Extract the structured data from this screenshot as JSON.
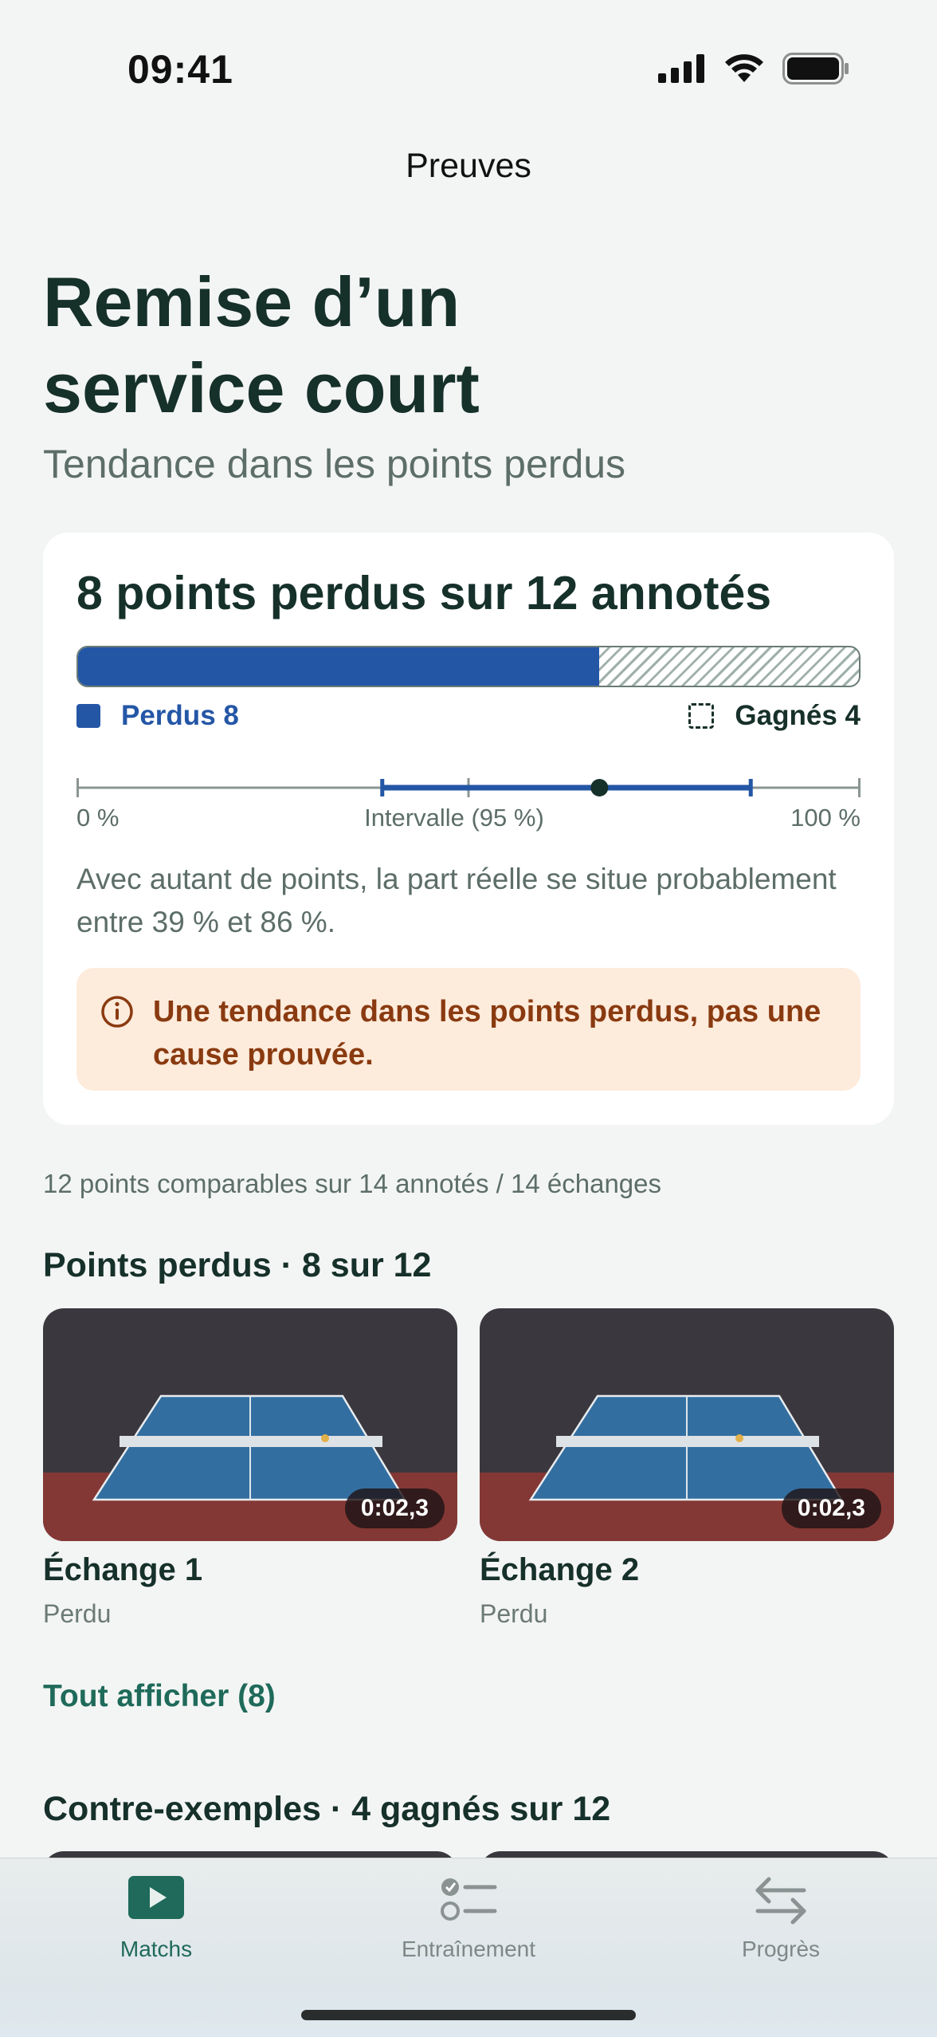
{
  "status_bar": {
    "time": "09:41"
  },
  "nav": {
    "title": "Preuves"
  },
  "header": {
    "title_line1": "Remise d’un",
    "title_line2": "service court",
    "subtitle": "Tendance dans les points perdus"
  },
  "card": {
    "title": "8 points perdus sur 12 annotés",
    "lost_count": 8,
    "total_count": 12,
    "lost_fraction": 0.667,
    "legend_lost": "Perdus 8",
    "legend_won": "Gagnés 4",
    "interval": {
      "label_min": "0 %",
      "label_mid": "Intervalle (95 %)",
      "label_max": "100 %",
      "low": 0.39,
      "high": 0.86,
      "point": 0.667
    },
    "explanation": "Avec autant de points, la part réelle se situe probablement entre 39 % et 86 %.",
    "note": "Une tendance dans les points perdus, pas une cause prouvée.",
    "colors": {
      "lost": "#2456a6",
      "note_bg": "#fdebdb",
      "note_text": "#8a3a10"
    }
  },
  "meta": "12 points comparables sur 14 annotés / 14 échanges",
  "lost_section": {
    "title": "Points perdus · 8 sur 12",
    "items": [
      {
        "title": "Échange 1",
        "status": "Perdu",
        "duration": "0:02,3"
      },
      {
        "title": "Échange 2",
        "status": "Perdu",
        "duration": "0:02,3"
      }
    ],
    "show_all": "Tout afficher (8)"
  },
  "counter_section": {
    "title": "Contre-exemples · 4 gagnés sur 12"
  },
  "tabbar": {
    "tabs": [
      {
        "label": "Matchs",
        "icon": "play-icon",
        "active": true
      },
      {
        "label": "Entraînement",
        "icon": "checklist-icon",
        "active": false
      },
      {
        "label": "Progrès",
        "icon": "arrows-swap-icon",
        "active": false
      }
    ],
    "accent": "#1f6a5a"
  }
}
